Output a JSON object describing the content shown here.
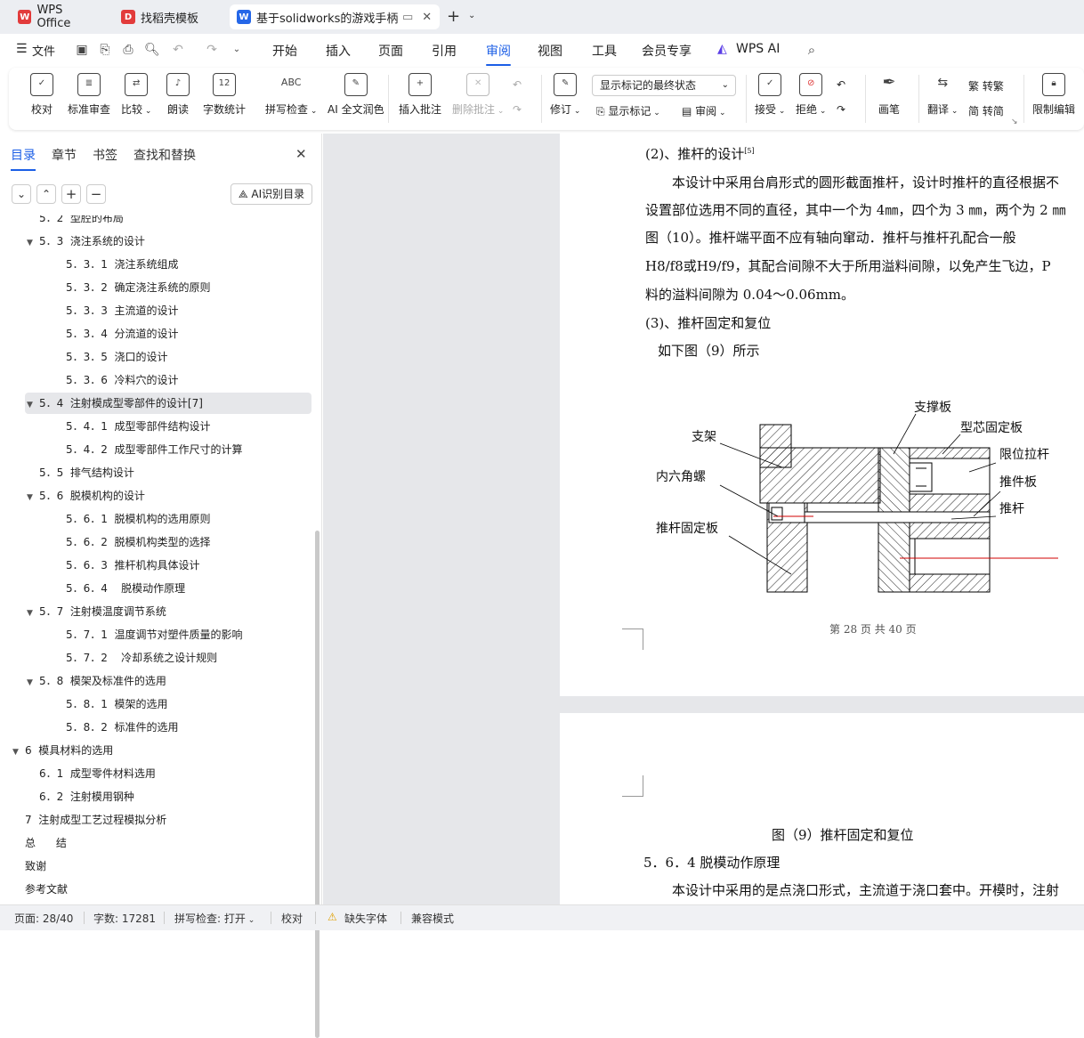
{
  "tabs": [
    {
      "label": "WPS Office"
    },
    {
      "label": "找稻壳模板"
    },
    {
      "label": "基于solidworks的游戏手柄"
    }
  ],
  "menu": {
    "file": "文件",
    "items": [
      "开始",
      "插入",
      "页面",
      "引用",
      "审阅",
      "视图",
      "工具",
      "会员专享",
      "WPS AI"
    ],
    "active": "审阅"
  },
  "ribbon": {
    "proofread": "校对",
    "std_review": "标准审查",
    "compare": "比较",
    "read_aloud": "朗读",
    "word_count": "字数统计",
    "spell_check": "拼写检查",
    "ai_polish": "AI 全文润色",
    "insert_comment": "插入批注",
    "delete_comment": "删除批注",
    "revise": "修订",
    "display_mode": "显示标记的最终状态",
    "show_markup": "显示标记",
    "review": "审阅",
    "accept": "接受",
    "reject": "拒绝",
    "pen": "画笔",
    "translate": "翻译",
    "to_trad": "转繁",
    "to_simp": "转简",
    "restrict_edit": "限制编辑",
    "word_count_icon_text": "12",
    "spell_icon_text": "ABC"
  },
  "panel": {
    "tabs": [
      "目录",
      "章节",
      "书签",
      "查找和替换"
    ],
    "ai_toc": "AI识别目录"
  },
  "toc": [
    {
      "label": "5．2  型腔的布局",
      "level": 2,
      "caret": false
    },
    {
      "label": "5．3  浇注系统的设计",
      "level": 2,
      "caret": true
    },
    {
      "label": "5．3．1  浇注系统组成",
      "level": 3,
      "caret": false
    },
    {
      "label": "5．3．2  确定浇注系统的原则",
      "level": 3,
      "caret": false
    },
    {
      "label": "5．3．3  主流道的设计",
      "level": 3,
      "caret": false
    },
    {
      "label": "5．3．4  分流道的设计",
      "level": 3,
      "caret": false
    },
    {
      "label": "5．3．5  浇口的设计",
      "level": 3,
      "caret": false
    },
    {
      "label": "5．3．6  冷料穴的设计",
      "level": 3,
      "caret": false
    },
    {
      "label": "5．4  注射模成型零部件的设计[7]",
      "level": 2,
      "caret": true,
      "selected": true
    },
    {
      "label": "5．4．1  成型零部件结构设计",
      "level": 3,
      "caret": false
    },
    {
      "label": "5．4．2  成型零部件工作尺寸的计算",
      "level": 3,
      "caret": false
    },
    {
      "label": "5．5  排气结构设计",
      "level": 2,
      "caret": false
    },
    {
      "label": "5．6  脱模机构的设计",
      "level": 2,
      "caret": true
    },
    {
      "label": "5．6．1  脱模机构的选用原则",
      "level": 3,
      "caret": false
    },
    {
      "label": "5．6．2  脱模机构类型的选择",
      "level": 3,
      "caret": false
    },
    {
      "label": "5．6．3  推杆机构具体设计",
      "level": 3,
      "caret": false
    },
    {
      "label": "5．6．4    脱模动作原理",
      "level": 3,
      "caret": false
    },
    {
      "label": "5．7  注射模温度调节系统",
      "level": 2,
      "caret": true
    },
    {
      "label": "5．7．1  温度调节对塑件质量的影响",
      "level": 3,
      "caret": false
    },
    {
      "label": "5．7．2    冷却系统之设计规则",
      "level": 3,
      "caret": false
    },
    {
      "label": "5．8  模架及标准件的选用",
      "level": 2,
      "caret": true
    },
    {
      "label": "5．8．1  模架的选用",
      "level": 3,
      "caret": false
    },
    {
      "label": "5．8．2  标准件的选用",
      "level": 3,
      "caret": false
    },
    {
      "label": "6  模具材料的选用",
      "level": 1,
      "caret": true
    },
    {
      "label": "6．1  成型零件材料选用",
      "level": 2,
      "caret": false
    },
    {
      "label": "6．2  注射模用钢种",
      "level": 2,
      "caret": false
    },
    {
      "label": "7  注射成型工艺过程模拟分析",
      "level": 1,
      "caret": false
    },
    {
      "label": "总      结",
      "level": 1,
      "caret": false
    },
    {
      "label": "致谢",
      "level": 1,
      "caret": false
    },
    {
      "label": "参考文献",
      "level": 1,
      "caret": false
    }
  ],
  "doc": {
    "heading_2": "(2)、推杆的设计",
    "heading_2_sup": "[5]",
    "para1_l1": "本设计中采用台肩形式的圆形截面推杆，设计时推杆的直径根据不",
    "para1_l2": "设置部位选用不同的直径，其中一个为 4㎜，四个为 3 ㎜，两个为 2 ㎜",
    "para1_l3": "图（10）。推杆端平面不应有轴向窜动．推杆与推杆孔配合一般",
    "para1_l4": "H8/f8或H9/f9，其配合间隙不大于所用溢料间隙，以免产生飞边，P",
    "para1_l5": "料的溢料间隙为 0.04～0.06mm。",
    "heading_3": "(3)、推杆固定和复位",
    "fig_ref": "如下图（9）所示",
    "fig_labels": {
      "support_plate": "支撑板",
      "core_plate": "型芯固定板",
      "bracket": "支架",
      "limit_rod": "限位拉杆",
      "hex_screw": "内六角螺",
      "ejector_plate": "推件板",
      "ejector_pin": "推杆",
      "pin_fix_plate": "推杆固定板"
    },
    "page_footer": "第 28 页 共 40 页",
    "fig_caption": "图（9）推杆固定和复位",
    "section_title": "5．6．4   脱模动作原理",
    "para2": "本设计中采用的是点浇口形式，主流道于浇口套中。开模时，注射"
  },
  "status": {
    "page": "页面: 28/40",
    "words": "字数: 17281",
    "spell": "拼写检查: 打开",
    "proof": "校对",
    "missing_font": "缺失字体",
    "compat": "兼容模式"
  },
  "colors": {
    "accent": "#1b5ee6",
    "wps_red": "#e23b3b",
    "wps_blue": "#2567e8",
    "red_line": "#d00000"
  }
}
